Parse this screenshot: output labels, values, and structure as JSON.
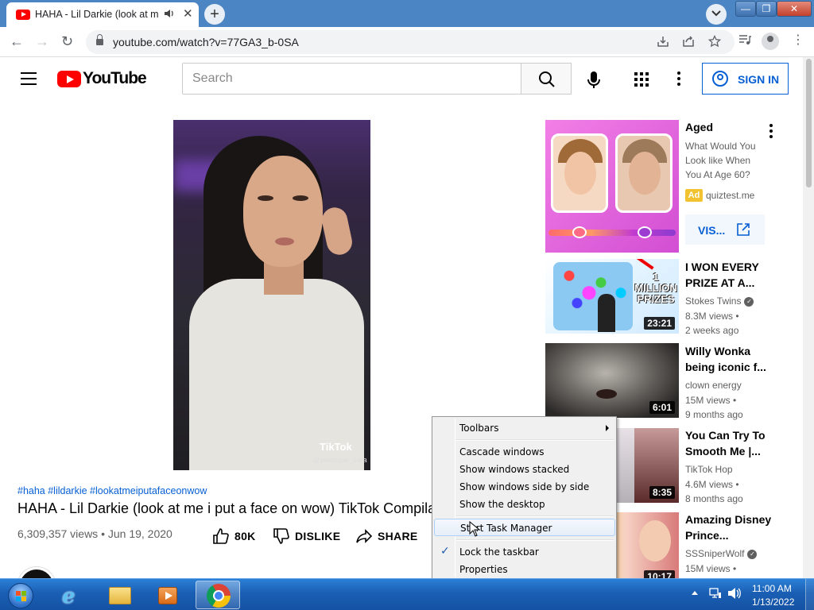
{
  "browser": {
    "tab_title": "HAHA - Lil Darkie (look at m",
    "tab_audio_icon": "speaker-icon",
    "tab_close": "✕",
    "new_tab": "+",
    "url": "youtube.com/watch?v=77GA3_b-0SA",
    "window_min": "—",
    "window_max": "❐",
    "window_close": "✕",
    "nav_back": "←",
    "nav_forward": "→",
    "nav_reload": "↻",
    "menu": "⋮"
  },
  "youtube": {
    "logo_text": "YouTube",
    "search_placeholder": "Search",
    "signin_label": "SIGN IN"
  },
  "video": {
    "watermark": "TikTok",
    "watermark_user": "@plastique_tiara",
    "hashtags": "#haha #lildarkie #lookatmeiputafaceonwow",
    "title": "HAHA - Lil Darkie (look at me i put a face on wow) TikTok Compilation",
    "meta": "6,309,357 views • Jun 19, 2020",
    "like_count": "80K",
    "dislike_label": "DISLIKE",
    "share_label": "SHARE"
  },
  "sidebar": {
    "ad": {
      "title": "Aged",
      "description": "What Would You Look like When You At Age 60?",
      "badge": "Ad",
      "domain": "quiztest.me",
      "cta": "VIS..."
    },
    "related": [
      {
        "title": "I WON EVERY PRIZE AT A...",
        "channel": "Stokes Twins",
        "verified": true,
        "views": "8.3M views •",
        "age": "2 weeks ago",
        "duration": "23:21",
        "thumb_text": "1 MILLION PRIZES"
      },
      {
        "title": "Willy Wonka being iconic f...",
        "channel": "clown energy",
        "verified": false,
        "views": "15M views •",
        "age": "9 months ago",
        "duration": "6:01"
      },
      {
        "title": "You Can Try To Smooth Me |...",
        "channel": "TikTok Hop",
        "verified": false,
        "views": "4.6M views •",
        "age": "8 months ago",
        "duration": "8:35"
      },
      {
        "title": "Amazing Disney Prince...",
        "channel": "SSSniperWolf",
        "verified": true,
        "views": "15M views •",
        "age": "",
        "duration": "10:17"
      }
    ]
  },
  "context_menu": {
    "items": [
      {
        "label": "Toolbars",
        "submenu": true
      },
      {
        "label": "Cascade windows"
      },
      {
        "label": "Show windows stacked"
      },
      {
        "label": "Show windows side by side"
      },
      {
        "label": "Show the desktop"
      },
      {
        "label": "Start Task Manager",
        "highlighted": true
      },
      {
        "label": "Lock the taskbar",
        "checked": true
      },
      {
        "label": "Properties"
      }
    ]
  },
  "taskbar": {
    "time": "11:00 AM",
    "date": "1/13/2022",
    "apps": [
      "internet-explorer",
      "windows-explorer",
      "windows-media-player",
      "google-chrome"
    ]
  },
  "colors": {
    "yt_red": "#ff0000",
    "yt_blue": "#065fd4",
    "taskbar": "#1a5fb4",
    "chrome_frame": "#4c85c3"
  }
}
